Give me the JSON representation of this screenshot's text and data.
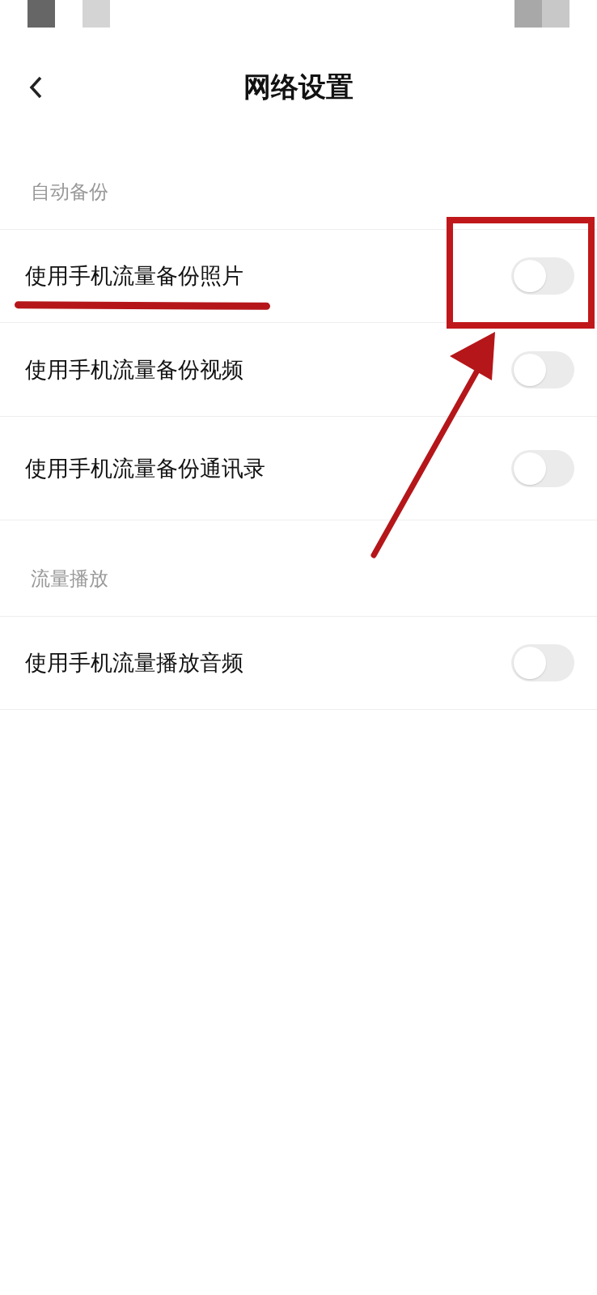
{
  "header": {
    "title": "网络设置"
  },
  "sections": [
    {
      "title": "自动备份",
      "items": [
        {
          "label": "使用手机流量备份照片",
          "on": false
        },
        {
          "label": "使用手机流量备份视频",
          "on": false
        },
        {
          "label": "使用手机流量备份通讯录",
          "on": false
        }
      ]
    },
    {
      "title": "流量播放",
      "items": [
        {
          "label": "使用手机流量播放音频",
          "on": false
        }
      ]
    }
  ]
}
